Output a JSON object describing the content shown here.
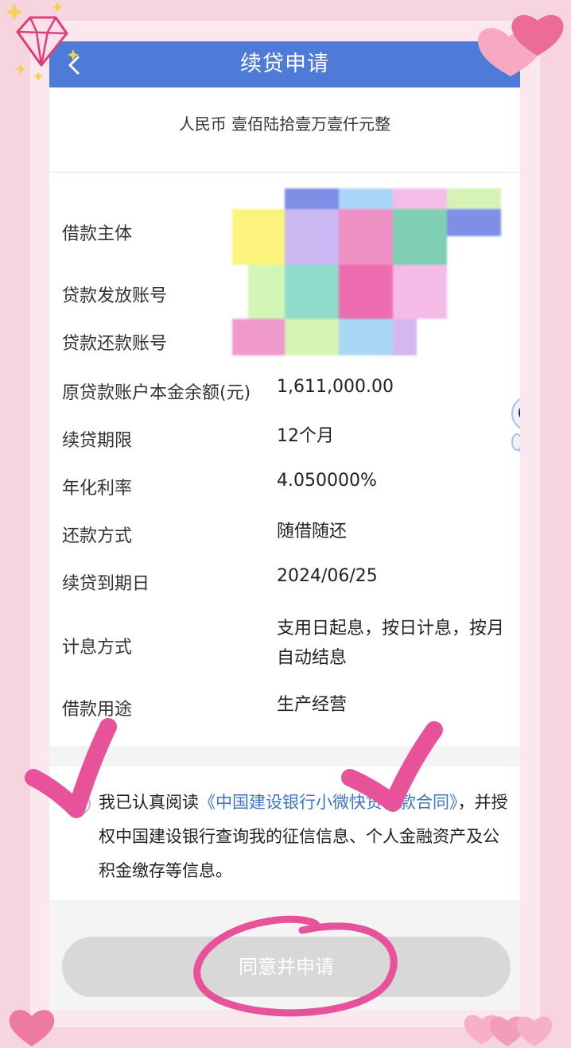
{
  "header": {
    "title": "续贷申请",
    "back_icon": "chevron-left-icon"
  },
  "amount_in_words": "人民币 壹佰陆拾壹万壹仟元整",
  "details": [
    {
      "label": "借款主体",
      "value": ""
    },
    {
      "label": "贷款发放账号",
      "value": ""
    },
    {
      "label": "贷款还款账号",
      "value": ""
    },
    {
      "label": "原贷款账户本金余额(元)",
      "value": "1,611,000.00"
    },
    {
      "label": "续贷期限",
      "value": "12个月"
    },
    {
      "label": "年化利率",
      "value": "4.050000%"
    },
    {
      "label": "还款方式",
      "value": "随借随还"
    },
    {
      "label": "续贷到期日",
      "value": "2024/06/25"
    },
    {
      "label": "计息方式",
      "value": "支用日起息，按日计息，按月自动结息"
    },
    {
      "label": "借款用途",
      "value": "生产经营"
    }
  ],
  "agreement": {
    "prefix": "我已认真阅读",
    "link": "《中国建设银行小微快贷借款合同》",
    "suffix": "，并授权中国建设银行查询我的征信信息、个人金融资产及公积金缴存等信息。",
    "checked": false
  },
  "submit_label": "同意并申请",
  "colors": {
    "nav_bar": "#4f7bd8",
    "link": "#3d74c9",
    "button_disabled": "#d8d8d8",
    "frame_pink": "#f7d5df",
    "marker_pink": "#e8529a"
  }
}
